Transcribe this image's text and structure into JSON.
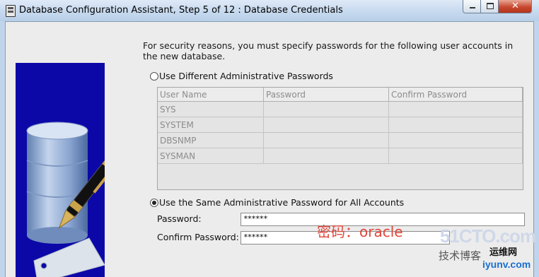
{
  "window": {
    "title": "Database Configuration Assistant, Step 5 of 12 : Database Credentials",
    "close_glyph": "✕"
  },
  "intro_text": "For security reasons, you must specify passwords for the following user accounts in the new database.",
  "options": {
    "different": {
      "label": "Use Different Administrative Passwords",
      "selected": false
    },
    "same": {
      "label": "Use the Same Administrative Password for All Accounts",
      "selected": true
    }
  },
  "table": {
    "headers": [
      "User Name",
      "Password",
      "Confirm Password"
    ],
    "rows": [
      [
        "SYS",
        "",
        ""
      ],
      [
        "SYSTEM",
        "",
        ""
      ],
      [
        "DBSNMP",
        "",
        ""
      ],
      [
        "SYSMAN",
        "",
        ""
      ]
    ]
  },
  "form": {
    "password_label": "Password:",
    "password_value": "******",
    "confirm_label": "Confirm Password:",
    "confirm_value": "******"
  },
  "annotation": "密码：oracle",
  "watermark": {
    "site": "51CTO.com",
    "tagline": "技术博客",
    "brand": "运维网",
    "domain": "iyunv.com"
  },
  "icons": [
    "app-icon",
    "minimize-icon",
    "maximize-icon",
    "close-icon",
    "database-icon",
    "pen-icon"
  ]
}
